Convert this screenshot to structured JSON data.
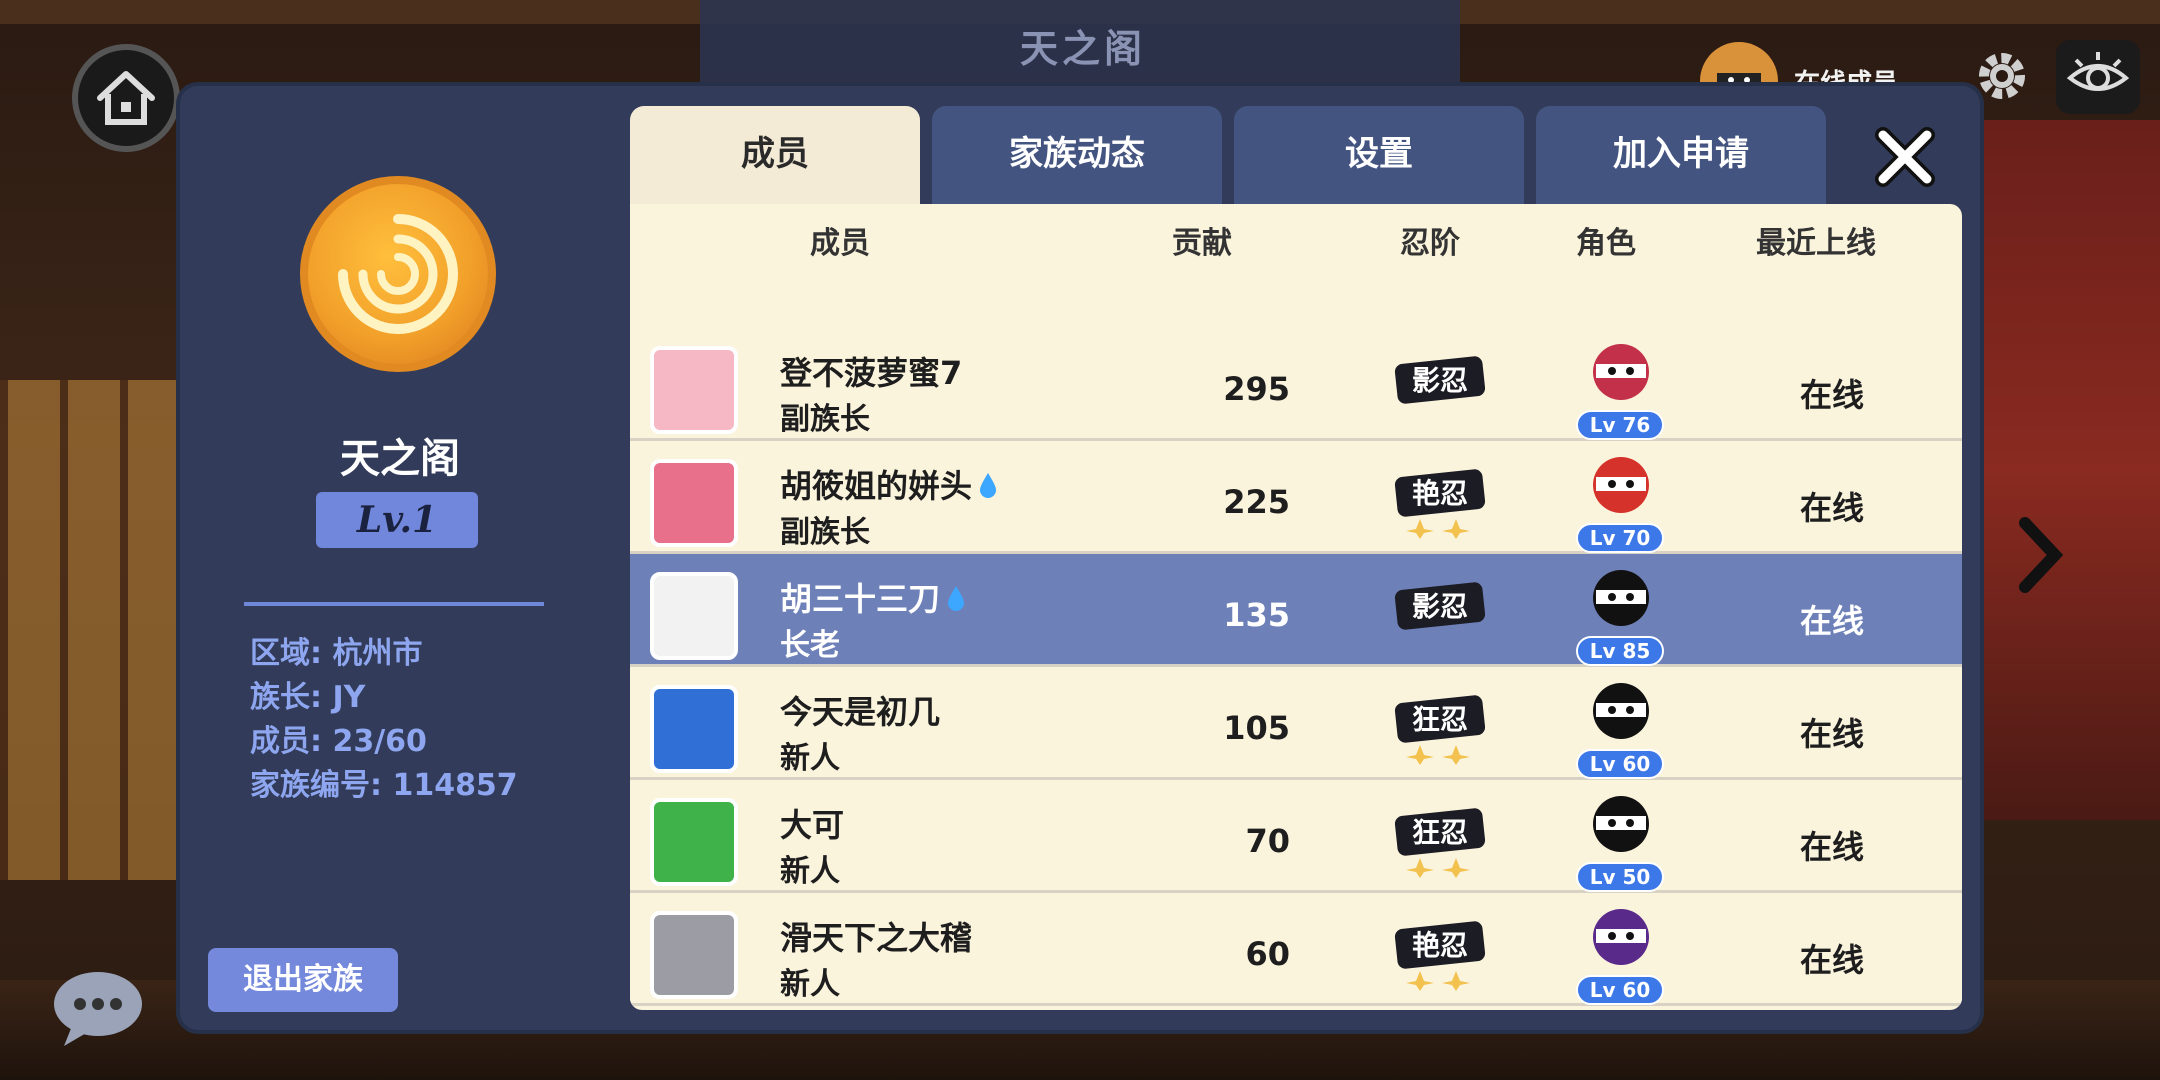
{
  "top_banner": {
    "title": "天之阁"
  },
  "online_badge": {
    "label": "在线成员"
  },
  "sidebar": {
    "clan_name": "天之阁",
    "level": "Lv.1",
    "info": [
      "区域: 杭州市",
      "族长: JY",
      "成员: 23/60",
      "家族编号: 114857"
    ],
    "leave_button": "退出家族"
  },
  "tabs": [
    {
      "label": "成员",
      "active": true
    },
    {
      "label": "家族动态",
      "active": false
    },
    {
      "label": "设置",
      "active": false
    },
    {
      "label": "加入申请",
      "active": false
    }
  ],
  "table": {
    "headers": {
      "member": "成员",
      "contribution": "贡献",
      "rank": "忍阶",
      "character": "角色",
      "last_online": "最近上线"
    },
    "rows": [
      {
        "name": "登不菠萝蜜7",
        "role": "副族长",
        "contribution": "295",
        "rank": "影忍",
        "level": "Lv 76",
        "status": "在线",
        "selected": false,
        "avatar_color": "#f6b8c4",
        "char_color": "#c3304a"
      },
      {
        "name": "胡筱姐的姘头",
        "role": "副族长",
        "contribution": "225",
        "rank": "艳忍",
        "level": "Lv 70",
        "status": "在线",
        "selected": false,
        "avatar_color": "#e8708a",
        "char_color": "#d4322a"
      },
      {
        "name": "胡三十三刀",
        "role": "长老",
        "contribution": "135",
        "rank": "影忍",
        "level": "Lv 85",
        "status": "在线",
        "selected": true,
        "avatar_color": "#f2f2f2",
        "char_color": "#111111"
      },
      {
        "name": "今天是初几",
        "role": "新人",
        "contribution": "105",
        "rank": "狂忍",
        "level": "Lv 60",
        "status": "在线",
        "selected": false,
        "avatar_color": "#2f6fd6",
        "char_color": "#111111"
      },
      {
        "name": "大可",
        "role": "新人",
        "contribution": "70",
        "rank": "狂忍",
        "level": "Lv 50",
        "status": "在线",
        "selected": false,
        "avatar_color": "#3fb24a",
        "char_color": "#111111"
      },
      {
        "name": "滑天下之大稽",
        "role": "新人",
        "contribution": "60",
        "rank": "艳忍",
        "level": "Lv 60",
        "status": "在线",
        "selected": false,
        "avatar_color": "#9c9ca4",
        "char_color": "#5a2a8a"
      }
    ]
  }
}
